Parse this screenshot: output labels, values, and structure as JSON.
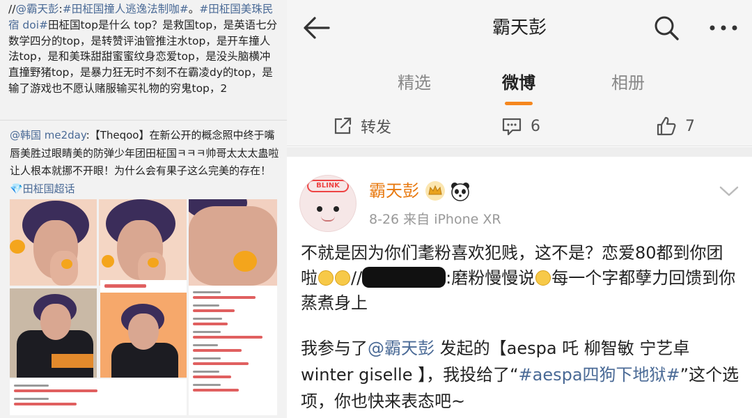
{
  "left": {
    "post": {
      "prefix": "//",
      "mention": "@霸天彭",
      "colon": ":",
      "hashtag1": "#田柾国撞人逃逸法制咖#",
      "dot": "。",
      "hashtag2": "#田柾国美珠民宿 doi#",
      "text": "田柾国top是什么 top？是救国top，是英语七分数学四分的top，是转赞评油管推注水top，是开车撞人法top，是和美珠甜甜蜜蜜纹身恋爱top，是没头脑横冲直撞野猪top，是暴力狂无时不刻不在霸凌dy的top，是输了游戏也不愿认赌服输买礼物的穷鬼top，2"
    },
    "repost": {
      "mention": "@韩国 me2day",
      "text": ":【Theqoo】在新公开的概念照中终于嘴唇美胜过眼睛美的防弹少年团田柾国ㅋㅋㅋ帅哥太太太蛊啦让人根本就挪不开眼！为什么会有果子这么完美的存在！",
      "tag": "💎田柾国超话"
    }
  },
  "right": {
    "title": "霸天彭",
    "tabs": [
      "精选",
      "微博",
      "相册"
    ],
    "active_tab": "微博",
    "actions": {
      "repost_label": "转发",
      "comment_count": "6",
      "like_count": "7"
    },
    "post": {
      "username": "霸天彭",
      "meta": "8-26  来自 iPhone XR",
      "avatar_text": "BLINK",
      "line1": "不就是因为你们耄粉喜欢犯贱，这不是？恋爱80都到你团啦",
      "line1b": "//",
      "line1c": ":磨粉慢慢说",
      "line1d": "每一个字都孽力回馈到你蒸煮身上",
      "p2_a": "我参与了",
      "p2_mention": "@霸天彭",
      "p2_b": " 发起的【aespa 吒 柳智敏 宁艺卓 winter giselle 】，我投给了“",
      "p2_tag": "#aespa四狗下地狱#",
      "p2_c": "”这个选项，你也快来表态吧~"
    },
    "colors": {
      "accent": "#f5871f",
      "link": "#4a6a96",
      "username": "#e8790f"
    }
  }
}
